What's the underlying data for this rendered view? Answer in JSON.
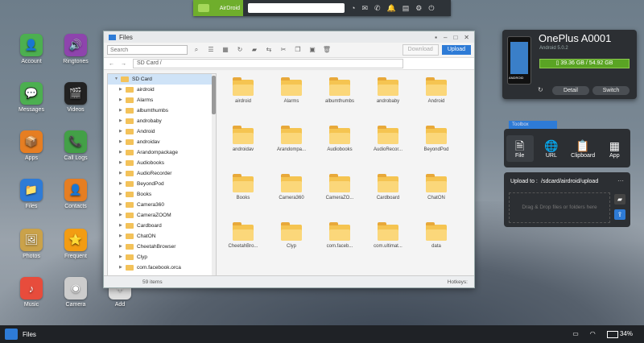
{
  "topbar": {
    "brand": "AirDroid",
    "search_placeholder": "",
    "icons": [
      "speed-icon",
      "mail-icon",
      "phone-icon",
      "notification-icon",
      "book-icon",
      "settings-icon",
      "power-icon"
    ]
  },
  "desktop": {
    "icons": [
      {
        "label": "Account",
        "color": "#4caf50",
        "glyph": "👤"
      },
      {
        "label": "Ringtones",
        "color": "#8e44ad",
        "glyph": "🔊"
      },
      {
        "label": "Messages",
        "color": "#4caf50",
        "glyph": "💬"
      },
      {
        "label": "Videos",
        "color": "#222",
        "glyph": "🎬"
      },
      {
        "label": "Apps",
        "color": "#e67e22",
        "glyph": "📦"
      },
      {
        "label": "Call Logs",
        "color": "#43a047",
        "glyph": "📞"
      },
      {
        "label": "Files",
        "color": "#2e7bd6",
        "glyph": "📁"
      },
      {
        "label": "Contacts",
        "color": "#e67e22",
        "glyph": "👤"
      },
      {
        "label": "Photos",
        "color": "#caa24a",
        "glyph": "🖼"
      },
      {
        "label": "Frequent",
        "color": "#f39c12",
        "glyph": "⭐"
      },
      {
        "label": "Music",
        "color": "#e74c3c",
        "glyph": "♪"
      },
      {
        "label": "Camera",
        "color": "#ccc",
        "glyph": "◉"
      },
      {
        "label": "Add",
        "color": "#ddd",
        "glyph": "+"
      }
    ]
  },
  "window": {
    "title": "Files",
    "search_placeholder": "Search",
    "download_label": "Download",
    "upload_label": "Upload",
    "path": "SD Card",
    "status_count": "59 items",
    "hotkeys_label": "Hotkeys:",
    "tree": [
      {
        "label": "SD Card",
        "selected": true
      },
      {
        "label": "airdroid"
      },
      {
        "label": "Alarms"
      },
      {
        "label": "albumthumbs"
      },
      {
        "label": "androbaby"
      },
      {
        "label": "Android"
      },
      {
        "label": "androidav"
      },
      {
        "label": "Arandompackage"
      },
      {
        "label": "Audiobooks"
      },
      {
        "label": "AudioRecorder"
      },
      {
        "label": "BeyondPod"
      },
      {
        "label": "Books"
      },
      {
        "label": "Camera360"
      },
      {
        "label": "CameraZOOM"
      },
      {
        "label": "Cardboard"
      },
      {
        "label": "ChatON"
      },
      {
        "label": "CheetahBrowser"
      },
      {
        "label": "Clyp"
      },
      {
        "label": "com.facebook.orca"
      }
    ],
    "folders": [
      "airdroid",
      "Alarms",
      "albumthumbs",
      "androbaby",
      "Android",
      "androidav",
      "Arandompa...",
      "Audiobooks",
      "AudioRecor...",
      "BeyondPod",
      "Books",
      "Camera360",
      "CameraZO...",
      "Cardboard",
      "ChatON",
      "CheetahBro...",
      "Clyp",
      "com.faceb...",
      "com.ultimat...",
      "data"
    ]
  },
  "device": {
    "name": "OnePlus A0001",
    "android_version": "Android 5.0.2",
    "storage": "39.36 GB / 54.92 GB",
    "storage_used_fraction": 0.717,
    "detail_label": "Detail",
    "switch_label": "Switch",
    "phone_screen_text": "ANDROID"
  },
  "toolbox": {
    "tab_label": "Toolbox",
    "tools": [
      {
        "label": "File",
        "glyph": "🗎"
      },
      {
        "label": "URL",
        "glyph": "🌐"
      },
      {
        "label": "Clipboard",
        "glyph": "📋"
      },
      {
        "label": "App",
        "glyph": "▦"
      }
    ]
  },
  "upload": {
    "label": "Upload to :",
    "path": "/sdcard/airdroid/upload",
    "more": "···",
    "drop_text": "Drag & Drop files or folders here"
  },
  "taskbar": {
    "task_label": "Files",
    "battery": "34%"
  }
}
